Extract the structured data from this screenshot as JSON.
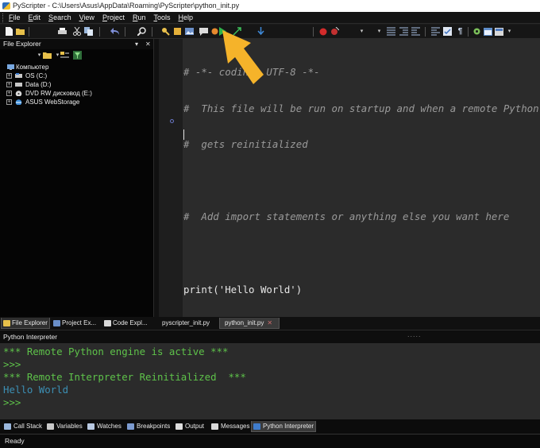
{
  "window": {
    "title": "PyScripter - C:\\Users\\Asus\\AppData\\Roaming\\PyScripter\\python_init.py"
  },
  "menu": [
    {
      "key": "F",
      "rest": "ile"
    },
    {
      "key": "E",
      "rest": "dit"
    },
    {
      "key": "S",
      "rest": "earch"
    },
    {
      "key": "V",
      "rest": "iew"
    },
    {
      "key": "P",
      "rest": "roject"
    },
    {
      "key": "R",
      "rest": "un"
    },
    {
      "key": "T",
      "rest": "ools"
    },
    {
      "key": "H",
      "rest": "elp"
    }
  ],
  "file_explorer": {
    "title": "File Explorer",
    "tree": [
      {
        "label": "Компьютер",
        "icon": "computer-icon",
        "expander": ""
      },
      {
        "label": "OS (C:)",
        "icon": "drive-icon",
        "expander": "+"
      },
      {
        "label": "Data (D:)",
        "icon": "drive-icon",
        "expander": "+"
      },
      {
        "label": "DVD RW дисковод (E:)",
        "icon": "dvd-icon",
        "expander": "+"
      },
      {
        "label": "ASUS WebStorage",
        "icon": "cloud-icon",
        "expander": "+"
      }
    ]
  },
  "left_tabs": [
    "File Explorer",
    "Project Ex...",
    "Code Expl..."
  ],
  "editor": {
    "tabs": [
      "pyscripter_init.py",
      "python_init.py"
    ],
    "active_tab": "python_init.py",
    "lines": [
      "# -*- coding: UTF-8 -*-",
      "#  This file will be run on startup and when a remote Python engine",
      "#  gets reinitialized",
      "",
      "#  Add import statements or anything else you want here",
      "",
      "print('Hello World')"
    ]
  },
  "interpreter": {
    "title": "Python Interpreter",
    "lines": [
      {
        "text": "*** Remote Python engine is active ***",
        "color": "#5ec24a"
      },
      {
        "text": ">>>",
        "color": "#5ec24a"
      },
      {
        "text": "*** Remote Interpreter Reinitialized  ***",
        "color": "#5ec24a"
      },
      {
        "text": "Hello World",
        "color": "#3c8fb4"
      },
      {
        "text": ">>>",
        "color": "#5ec24a"
      }
    ]
  },
  "bottom_tabs": [
    "Call Stack",
    "Variables",
    "Watches",
    "Breakpoints",
    "Output",
    "Messages",
    "Python Interpreter"
  ],
  "status": {
    "text": "Ready"
  },
  "colors": {
    "accent_arrow": "#f5b32a",
    "editor_bg": "#2b2b2b",
    "prompt_green": "#5ec24a",
    "output_blue": "#3c8fb4"
  }
}
